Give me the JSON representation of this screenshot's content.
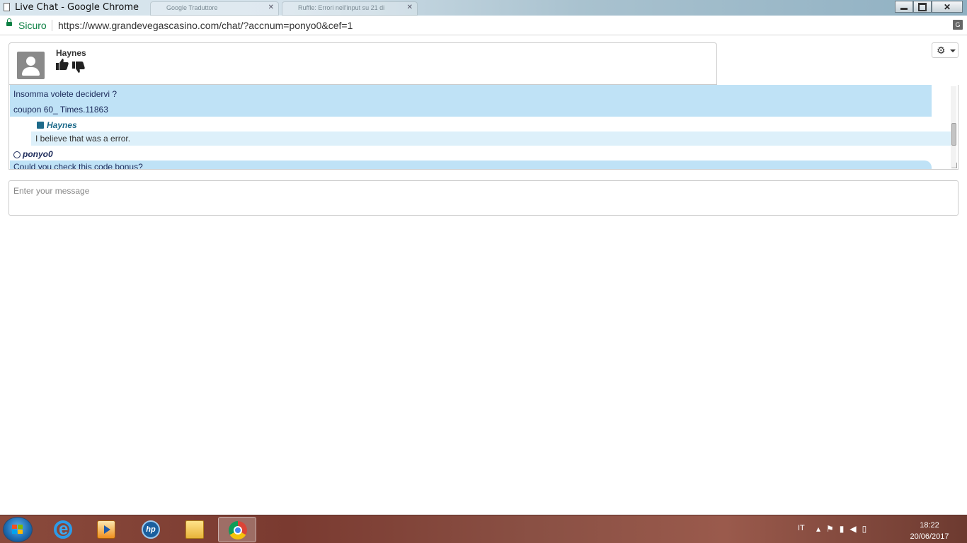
{
  "window": {
    "title": "Live Chat - Google Chrome",
    "bg_tabs": [
      "Google Traduttore",
      "Ruffle: Errori nell'input su 21 di"
    ]
  },
  "addressbar": {
    "secure_label": "Sicuro",
    "url": "https://www.grandevegascasino.com/chat/?accnum=ponyo0&cef=1"
  },
  "chat": {
    "agent_name": "Haynes",
    "messages": {
      "visitor_line1": "Insomma volete decidervi ?",
      "visitor_line2": "coupon 60_ Times.11863",
      "agent_sender": "Haynes",
      "agent_text": "I believe that was a error.",
      "visitor_sender": "ponyo0",
      "visitor_text": "Could you check this code bonus?"
    },
    "input_placeholder": "Enter your message"
  },
  "taskbar": {
    "language": "IT",
    "time": "18:22",
    "date": "20/06/2017"
  },
  "colors": {
    "visitor_bubble": "#bfe2f6",
    "agent_bubble": "#ddf0fa",
    "secure_green": "#0b8043"
  }
}
